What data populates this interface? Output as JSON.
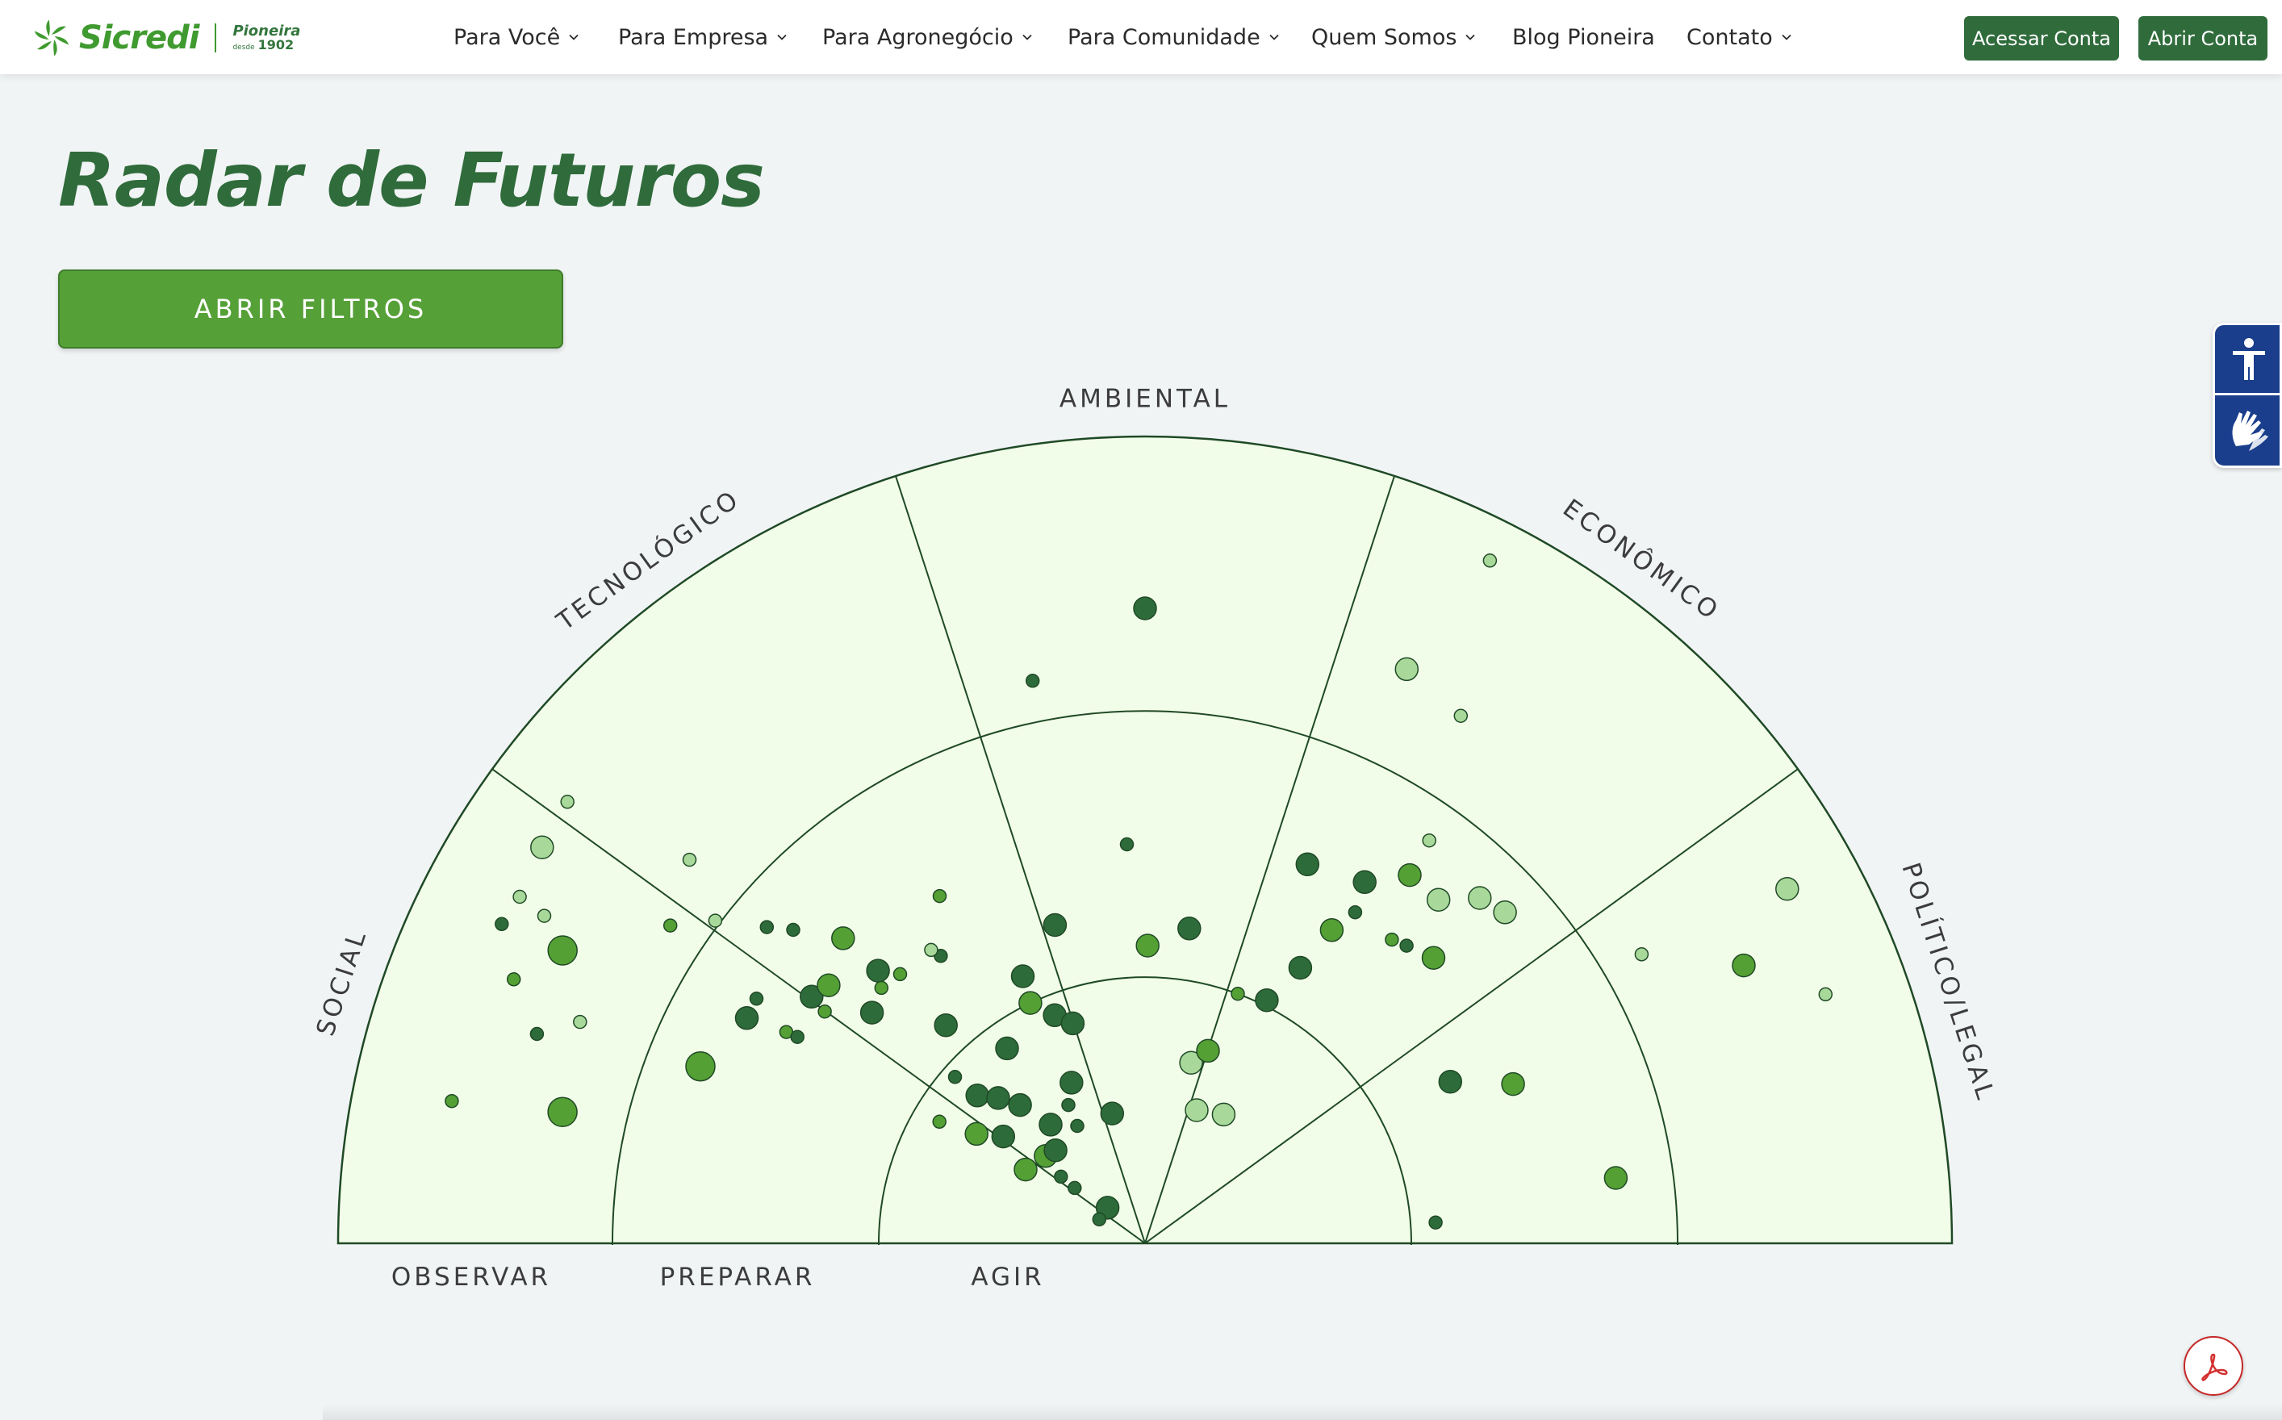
{
  "brand": {
    "name": "Sicredi",
    "tag_line1": "Pioneira",
    "tag_small": "desde",
    "tag_year": "1902"
  },
  "nav": {
    "items": [
      {
        "label": "Para Você",
        "has_menu": true
      },
      {
        "label": "Para Empresa",
        "has_menu": true
      },
      {
        "label": "Para Agronegócio",
        "has_menu": true
      },
      {
        "label": "Para Comunidade",
        "has_menu": true
      },
      {
        "label": "Quem Somos",
        "has_menu": true
      },
      {
        "label": "Blog Pioneira",
        "has_menu": false
      },
      {
        "label": "Contato",
        "has_menu": true
      }
    ],
    "acessar_label": "Acessar Conta",
    "abrir_label": "Abrir Conta"
  },
  "page": {
    "title": "Radar de Futuros",
    "filters_button": "ABRIR FILTROS"
  },
  "radar": {
    "sectors": [
      "SOCIAL",
      "TECNOLÓGICO",
      "AMBIENTAL",
      "ECONÔMICO",
      "POLÍTICO/LEGAL"
    ],
    "rings": [
      "AGIR",
      "PREPARAR",
      "OBSERVAR"
    ],
    "ring_labels_left": [
      "OBSERVAR",
      "PREPARAR",
      "AGIR"
    ],
    "colors": {
      "dark": "#2e6b3a",
      "medium": "#54a034",
      "light": "#a9d99a",
      "field": "#f2fde9",
      "stroke": "#1f4a26"
    },
    "legend_note": "",
    "points": [
      {
        "a": 168.4,
        "r": 0.877,
        "s": "s",
        "c": "m"
      },
      {
        "a": 161.0,
        "r": 0.797,
        "s": "s",
        "c": "d"
      },
      {
        "a": 153.6,
        "r": 0.89,
        "s": "s",
        "c": "d"
      },
      {
        "a": 151.0,
        "r": 0.886,
        "s": "s",
        "c": "l"
      },
      {
        "a": 157.3,
        "r": 0.848,
        "s": "s",
        "c": "m"
      },
      {
        "a": 153.3,
        "r": 0.808,
        "s": "l",
        "c": "m"
      },
      {
        "a": 151.4,
        "r": 0.848,
        "s": "s",
        "c": "l"
      },
      {
        "a": 146.7,
        "r": 0.894,
        "s": "m",
        "c": "l"
      },
      {
        "a": 139.9,
        "r": 0.738,
        "s": "s",
        "c": "l"
      },
      {
        "a": 143.1,
        "r": 0.666,
        "s": "s",
        "c": "l"
      },
      {
        "a": 146.2,
        "r": 0.708,
        "s": "s",
        "c": "m"
      },
      {
        "a": 140.1,
        "r": 0.611,
        "s": "s",
        "c": "d"
      },
      {
        "a": 138.3,
        "r": 0.584,
        "s": "s",
        "c": "d"
      },
      {
        "a": 147.8,
        "r": 0.569,
        "s": "s",
        "c": "d"
      },
      {
        "a": 158.6,
        "r": 0.752,
        "s": "s",
        "c": "l"
      },
      {
        "a": 167.3,
        "r": 0.74,
        "s": "l",
        "c": "m"
      },
      {
        "a": 142.6,
        "r": 0.901,
        "s": "s",
        "c": "l"
      },
      {
        "a": 150.5,
        "r": 0.567,
        "s": "m",
        "c": "d"
      },
      {
        "a": 149.5,
        "r": 0.516,
        "s": "s",
        "c": "m"
      },
      {
        "a": 144.1,
        "r": 0.49,
        "s": "s",
        "c": "m"
      },
      {
        "a": 143.5,
        "r": 0.514,
        "s": "m",
        "c": "d"
      },
      {
        "a": 158.3,
        "r": 0.593,
        "s": "l",
        "c": "m"
      },
      {
        "a": 149.3,
        "r": 0.501,
        "s": "s",
        "c": "d"
      },
      {
        "a": 140.8,
        "r": 0.506,
        "s": "m",
        "c": "m"
      },
      {
        "a": 135.9,
        "r": 0.455,
        "s": "s",
        "c": "m"
      },
      {
        "a": 134.7,
        "r": 0.532,
        "s": "m",
        "c": "m"
      },
      {
        "a": 139.8,
        "r": 0.443,
        "s": "m",
        "c": "d"
      },
      {
        "a": 132.3,
        "r": 0.451,
        "s": "s",
        "c": "m"
      },
      {
        "a": 134.4,
        "r": 0.473,
        "s": "m",
        "c": "d"
      },
      {
        "a": 132.4,
        "r": 0.366,
        "s": "m",
        "c": "d"
      },
      {
        "a": 125.4,
        "r": 0.437,
        "s": "s",
        "c": "d"
      },
      {
        "a": 126.1,
        "r": 0.45,
        "s": "s",
        "c": "l"
      },
      {
        "a": 120.6,
        "r": 0.5,
        "s": "s",
        "c": "m"
      },
      {
        "a": 138.8,
        "r": 0.313,
        "s": "s",
        "c": "d"
      },
      {
        "a": 147.0,
        "r": 0.249,
        "s": "m",
        "c": "m"
      },
      {
        "a": 143.0,
        "r": 0.22,
        "s": "m",
        "c": "d"
      },
      {
        "a": 149.4,
        "r": 0.296,
        "s": "s",
        "c": "m"
      },
      {
        "a": 138.6,
        "r": 0.277,
        "s": "m",
        "c": "d"
      },
      {
        "a": 135.3,
        "r": 0.256,
        "s": "m",
        "c": "d"
      },
      {
        "a": 132.1,
        "r": 0.231,
        "s": "m",
        "c": "d"
      },
      {
        "a": 125.3,
        "r": 0.296,
        "s": "m",
        "c": "d"
      },
      {
        "a": 115.5,
        "r": 0.33,
        "s": "m",
        "c": "m"
      },
      {
        "a": 105.8,
        "r": 0.41,
        "s": "m",
        "c": "d"
      },
      {
        "a": 114.6,
        "r": 0.364,
        "s": "m",
        "c": "d"
      },
      {
        "a": 111.6,
        "r": 0.304,
        "s": "m",
        "c": "d"
      },
      {
        "a": 128.5,
        "r": 0.188,
        "s": "m",
        "c": "d"
      },
      {
        "a": 119.0,
        "r": 0.196,
        "s": "s",
        "c": "d"
      },
      {
        "a": 138.7,
        "r": 0.164,
        "s": "m",
        "c": "m"
      },
      {
        "a": 133.9,
        "r": 0.16,
        "s": "m",
        "c": "d"
      },
      {
        "a": 120.0,
        "r": 0.168,
        "s": "s",
        "c": "d"
      },
      {
        "a": 114.6,
        "r": 0.219,
        "s": "m",
        "c": "d"
      },
      {
        "a": 104.2,
        "r": 0.166,
        "s": "m",
        "c": "d"
      },
      {
        "a": 136.5,
        "r": 0.064,
        "s": "m",
        "c": "d"
      },
      {
        "a": 152.3,
        "r": 0.064,
        "s": "s",
        "c": "d"
      },
      {
        "a": 148.3,
        "r": 0.174,
        "s": "m",
        "c": "m"
      },
      {
        "a": 141.6,
        "r": 0.133,
        "s": "s",
        "c": "d"
      },
      {
        "a": 141.8,
        "r": 0.111,
        "s": "s",
        "c": "d"
      },
      {
        "a": 108.2,
        "r": 0.287,
        "s": "m",
        "c": "d"
      },
      {
        "a": 92.6,
        "r": 0.495,
        "s": "s",
        "c": "d"
      },
      {
        "a": 101.3,
        "r": 0.711,
        "s": "s",
        "c": "d"
      },
      {
        "a": 90.0,
        "r": 0.787,
        "s": "m",
        "c": "d"
      },
      {
        "a": 89.5,
        "r": 0.369,
        "s": "m",
        "c": "m"
      },
      {
        "a": 82.0,
        "r": 0.394,
        "s": "m",
        "c": "d"
      },
      {
        "a": 69.6,
        "r": 0.33,
        "s": "s",
        "c": "m"
      },
      {
        "a": 75.7,
        "r": 0.231,
        "s": "m",
        "c": "l"
      },
      {
        "a": 68.8,
        "r": 0.177,
        "s": "m",
        "c": "l"
      },
      {
        "a": 58.6,
        "r": 0.187,
        "s": "m",
        "c": "l"
      },
      {
        "a": 63.4,
        "r": 0.337,
        "s": "m",
        "c": "d"
      },
      {
        "a": 71.9,
        "r": 0.251,
        "s": "m",
        "c": "m"
      },
      {
        "a": 60.6,
        "r": 0.392,
        "s": "m",
        "c": "d"
      },
      {
        "a": 66.8,
        "r": 0.511,
        "s": "m",
        "c": "d"
      },
      {
        "a": 58.7,
        "r": 0.524,
        "s": "m",
        "c": "d"
      },
      {
        "a": 57.6,
        "r": 0.486,
        "s": "s",
        "c": "d"
      },
      {
        "a": 50.9,
        "r": 0.485,
        "s": "s",
        "c": "m"
      },
      {
        "a": 54.3,
        "r": 0.562,
        "s": "m",
        "c": "m"
      },
      {
        "a": 48.7,
        "r": 0.491,
        "s": "s",
        "c": "d"
      },
      {
        "a": 49.5,
        "r": 0.56,
        "s": "m",
        "c": "l"
      },
      {
        "a": 54.8,
        "r": 0.611,
        "s": "s",
        "c": "l"
      },
      {
        "a": 45.9,
        "r": 0.596,
        "s": "m",
        "c": "l"
      },
      {
        "a": 44.7,
        "r": 0.503,
        "s": "m",
        "c": "m"
      },
      {
        "a": 42.6,
        "r": 0.606,
        "s": "m",
        "c": "l"
      },
      {
        "a": 59.2,
        "r": 0.452,
        "s": "m",
        "c": "m"
      },
      {
        "a": 65.5,
        "r": 0.782,
        "s": "m",
        "c": "l"
      },
      {
        "a": 59.1,
        "r": 0.762,
        "s": "s",
        "c": "l"
      },
      {
        "a": 63.2,
        "r": 0.948,
        "s": "s",
        "c": "l"
      },
      {
        "a": 27.9,
        "r": 0.428,
        "s": "m",
        "c": "d"
      },
      {
        "a": 23.4,
        "r": 0.497,
        "s": "m",
        "c": "m"
      },
      {
        "a": 4.1,
        "r": 0.361,
        "s": "s",
        "c": "d"
      },
      {
        "a": 7.9,
        "r": 0.589,
        "s": "m",
        "c": "m"
      },
      {
        "a": 30.2,
        "r": 0.712,
        "s": "s",
        "c": "l"
      },
      {
        "a": 24.9,
        "r": 0.818,
        "s": "m",
        "c": "m"
      },
      {
        "a": 28.9,
        "r": 0.909,
        "s": "m",
        "c": "l"
      },
      {
        "a": 20.1,
        "r": 0.898,
        "s": "s",
        "c": "l"
      }
    ]
  }
}
